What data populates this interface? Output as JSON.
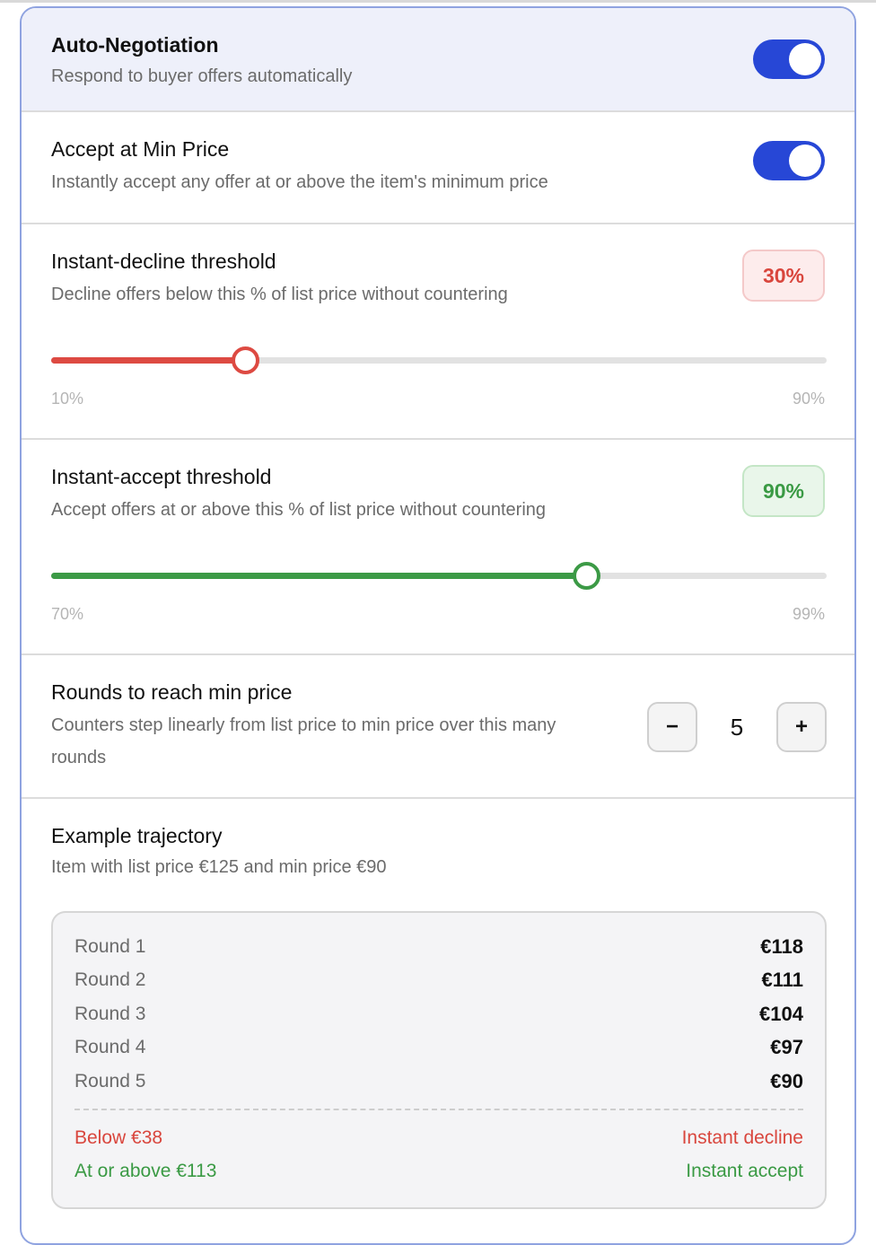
{
  "auto_negotiation": {
    "title": "Auto-Negotiation",
    "description": "Respond to buyer offers automatically",
    "enabled": true
  },
  "accept_min_price": {
    "title": "Accept at Min Price",
    "description": "Instantly accept any offer at or above the item's minimum price",
    "enabled": true
  },
  "instant_decline": {
    "title": "Instant-decline threshold",
    "description": "Decline offers below this % of list price without countering",
    "value_label": "30%",
    "value": 30,
    "min_label": "10%",
    "max_label": "90%",
    "min": 10,
    "max": 90,
    "color": "#dd4a42"
  },
  "instant_accept": {
    "title": "Instant-accept threshold",
    "description": "Accept offers at or above this % of list price without countering",
    "value_label": "90%",
    "value": 90,
    "min_label": "70%",
    "max_label": "99%",
    "min": 70,
    "max": 99,
    "color": "#3c9a46"
  },
  "rounds": {
    "title": "Rounds to reach min price",
    "description": "Counters step linearly from list price to min price over this many rounds",
    "value": "5",
    "minus_label": "−",
    "plus_label": "+"
  },
  "example": {
    "title": "Example trajectory",
    "subtitle": "Item with list price €125 and min price €90",
    "rounds": [
      {
        "label": "Round 1",
        "price": "€118"
      },
      {
        "label": "Round 2",
        "price": "€111"
      },
      {
        "label": "Round 3",
        "price": "€104"
      },
      {
        "label": "Round 4",
        "price": "€97"
      },
      {
        "label": "Round 5",
        "price": "€90"
      }
    ],
    "decline_rule": {
      "label": "Below €38",
      "action": "Instant decline"
    },
    "accept_rule": {
      "label": "At or above €113",
      "action": "Instant accept"
    }
  }
}
